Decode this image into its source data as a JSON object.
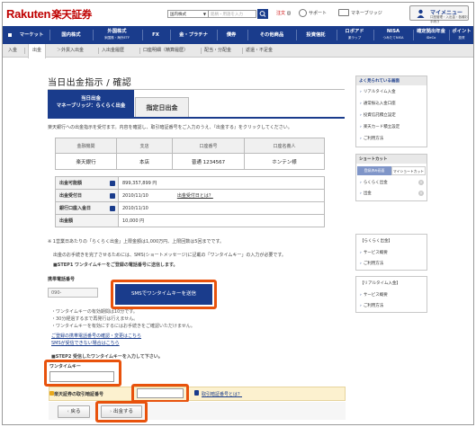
{
  "header": {
    "logo_latin": "Rakuten",
    "logo_jp": "楽天証券",
    "market_select": "国内株式",
    "search_placeholder": "銘柄・用語を入力",
    "links": [
      {
        "label": "注文",
        "red": true,
        "badge": "0"
      },
      {
        "label": "サポート"
      },
      {
        "label": "マネーブリッジ"
      }
    ],
    "mypage_label": "マイメニュー",
    "mypage_sub": "口座管理・入出金・各種お手続き"
  },
  "mainnav": [
    {
      "label": "マーケット"
    },
    {
      "label": "国内株式"
    },
    {
      "label": "外国株式",
      "sub": "米国株・海外ETF"
    },
    {
      "label": "FX"
    },
    {
      "label": "金・プラチナ"
    },
    {
      "label": "債券"
    },
    {
      "label": "その他商品"
    },
    {
      "label": "投資信託"
    },
    {
      "label": "ロボアド",
      "sub": "楽ラップ"
    },
    {
      "label": "NISA",
      "sub": "つみたてNISA"
    },
    {
      "label": "確定拠出年金",
      "sub": "iDeCo"
    },
    {
      "label": "ポイント",
      "sub": "投資"
    }
  ],
  "subnav": [
    "入金",
    "出金",
    "外貨入出金",
    "入出金履歴",
    "口座明細（精算履歴）",
    "配当・分配金",
    "返還・不足金"
  ],
  "page_title": "当日出金指示 / 確認",
  "tabs": {
    "active_line1": "当日出金",
    "active_line2": "マネーブリッジ：らくらく出金",
    "inactive": "指定日出金"
  },
  "description": "楽天銀行への出金指示を受付ます。内容を確認し、取引暗証番号をご入力のうえ、『出金する』をクリックしてください。",
  "bank_table": {
    "headers": [
      "金融機関",
      "支店",
      "口座番号",
      "口座名義人"
    ],
    "row": [
      "楽天銀行",
      "本店",
      "普通 1234567",
      "ホンテン様"
    ]
  },
  "info_table": [
    {
      "label": "出金可能額",
      "value": "899,357,899 円"
    },
    {
      "label": "出金受付日",
      "value": "2010/11/10",
      "link": "出金受付日とは？"
    },
    {
      "label": "銀行口座入金日",
      "value": "2010/11/10"
    },
    {
      "label": "出金額",
      "value": "10,000 円"
    }
  ],
  "limit_note": "※ 1営業日あたりの「らくらく出金」上限金額は1,000万円、上限回数は5回までです。",
  "sms_note1": "出金のお手続きを完了させるためには、SMS(ショートメッセージ)に記載の「ワンタイムキー」の入力が必要です。",
  "sms_step1": "■STEP1 ワンタイムキーをご登録の電話番号に送信します。",
  "phone_label": "携帯電話番号",
  "phone_value": "090-",
  "sms_button": "SMSでワンタイムキーを送信",
  "bullets": [
    "・ワンタイムキーの有効期間は10分です。",
    "・30分経過するまで再発行は行えません。",
    "・ワンタイムキーを有効にするにはお手続きをご確認いただけません。"
  ],
  "links": [
    "ご登録の携帯電話番号の確認・変更はこちら",
    "SMSが受信できない場合はこちら"
  ],
  "step2": "■STEP2 受信したワンタイムキーを入力して下さい。",
  "otk_label": "ワンタイムキー",
  "pw_label": "楽天証券の取引暗証番号",
  "pw_help": "取引暗証番号とは？",
  "buttons": {
    "back": "戻る",
    "submit": "出金する"
  },
  "sidebar": {
    "recent_title": "よく見られている画面",
    "recent": [
      "リアルタイム入金",
      "通常振込入金口座",
      "投資信託積立設定",
      "楽天カード積立設定",
      "ご利用方法"
    ],
    "shortcut_title": "ショートカット",
    "shortcut_tabs": [
      "登録済み画面",
      "マイショートカット"
    ],
    "shortcut_items": [
      "らくらく出金",
      "出金"
    ],
    "box3_title": "【らくらく出金】",
    "box3_items": [
      "サービス概要",
      "ご利用方法"
    ],
    "box4_title": "【リアルタイム入金】",
    "box4_items": [
      "サービス概要",
      "ご利用方法"
    ]
  },
  "colors": {
    "brand_red": "#bf0000",
    "nav_blue": "#1a3c8c",
    "highlight_orange": "#e8520c"
  }
}
